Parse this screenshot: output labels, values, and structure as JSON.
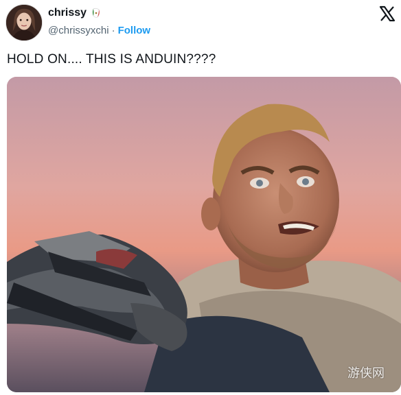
{
  "user": {
    "display_name": "chrissy",
    "handle": "@chrissyxchi",
    "separator": "·",
    "follow_label": "Follow"
  },
  "post": {
    "text": "HOLD ON.... THIS IS ANDUIN????"
  },
  "icons": {
    "avatar": "avatar-icon",
    "name_badge": "mexico-flag-icon",
    "brand": "x-logo-icon"
  },
  "colors": {
    "text_primary": "#0f1419",
    "text_secondary": "#536471",
    "accent": "#1d9bf0"
  },
  "media": {
    "watermark": "游侠网"
  }
}
